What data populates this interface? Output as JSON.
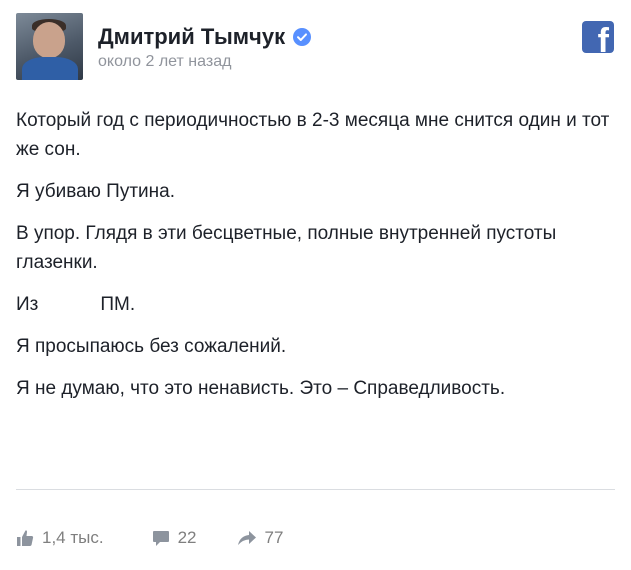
{
  "post": {
    "author": "Дмитрий Тымчук",
    "timestamp": "около 2 лет назад",
    "paragraphs": [
      "Который год с периодичностью в 2-3 месяца мне снится один и тот же сон.",
      "Я убиваю Путина.",
      "В упор. Глядя в эти бесцветные, полные внутренней пустоты глазенки.",
      null,
      "Я просыпаюсь без сожалений.",
      "Я не думаю, что это ненависть. Это – Справедливость."
    ],
    "weapon_line": {
      "before": "Из",
      "after": "ПМ."
    }
  },
  "reactions": {
    "likes": "1,4 тыс.",
    "comments": "22",
    "shares": "77"
  },
  "icons": {
    "verified": "verified-badge-icon",
    "platform": "facebook-icon",
    "like": "thumbs-up-icon",
    "comment": "comment-icon",
    "share": "share-arrow-icon"
  },
  "colors": {
    "facebook_blue": "#4267b2",
    "verified_blue": "#5890ff",
    "text": "#1d2129",
    "meta_gray": "#90949c"
  }
}
